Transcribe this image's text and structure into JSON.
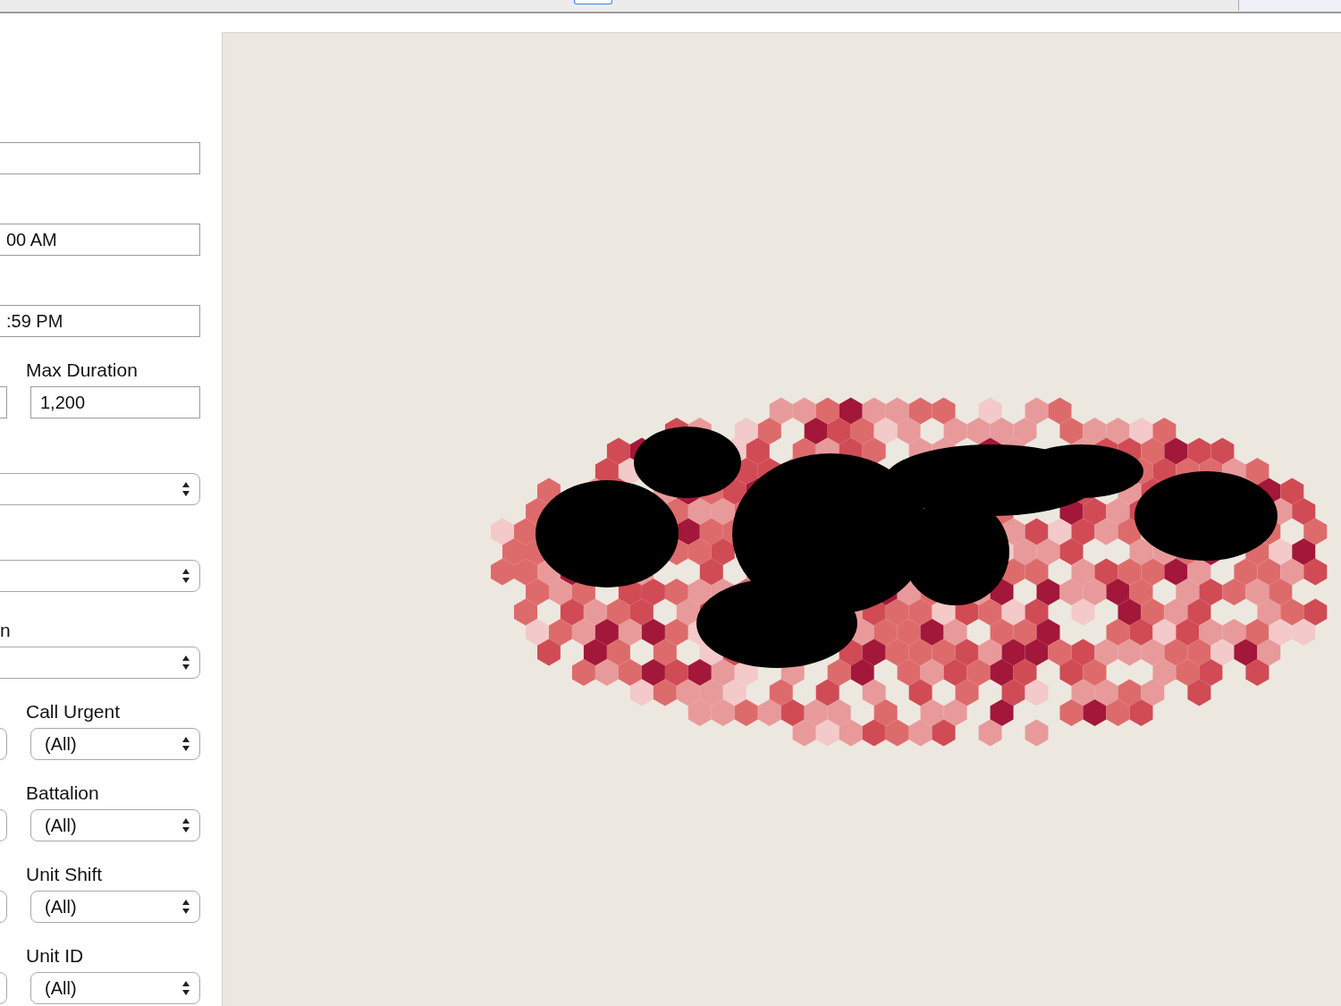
{
  "filters": [
    {
      "kind": "input"
    },
    {
      "kind": "input",
      "value": "00 AM"
    },
    {
      "kind": "input",
      "value": ":59 PM"
    },
    {
      "kind": "input_pair",
      "label": "Max Duration",
      "value": "1,200"
    },
    {
      "kind": "select"
    },
    {
      "kind": "select"
    },
    {
      "kind": "select",
      "label": "n"
    },
    {
      "kind": "select_pair",
      "label": "Call Urgent",
      "value": "(All)"
    },
    {
      "kind": "select_pair",
      "label": "Battalion",
      "value": "(All)"
    },
    {
      "kind": "select_pair",
      "label": "Unit Shift",
      "value": "(All)"
    },
    {
      "kind": "select_pair",
      "label": "Unit ID",
      "value": "(All)"
    }
  ]
}
